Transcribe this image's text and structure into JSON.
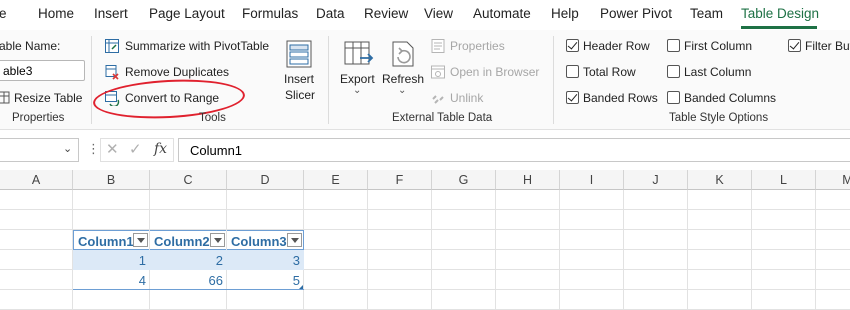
{
  "menu": {
    "tabs": [
      "e",
      "Home",
      "Insert",
      "Page Layout",
      "Formulas",
      "Data",
      "Review",
      "View",
      "Automate",
      "Help",
      "Power Pivot",
      "Team",
      "Table Design"
    ],
    "active": "Table Design"
  },
  "ribbon": {
    "properties": {
      "table_name_label": "able Name:",
      "table_name_value": "able3",
      "resize_label": "Resize Table",
      "group_label": "Properties"
    },
    "tools": {
      "summarize_label": "Summarize with PivotTable",
      "remove_duplicates_label": "Remove Duplicates",
      "convert_label": "Convert to Range",
      "insert_slicer_line1": "Insert",
      "insert_slicer_line2": "Slicer",
      "group_label": "Tools"
    },
    "external": {
      "export_label": "Export",
      "refresh_label": "Refresh",
      "properties_label": "Properties",
      "open_browser_label": "Open in Browser",
      "unlink_label": "Unlink",
      "group_label": "External Table Data"
    },
    "style_options": {
      "header_row": "Header Row",
      "total_row": "Total Row",
      "banded_rows": "Banded Rows",
      "first_column": "First Column",
      "last_column": "Last Column",
      "banded_columns": "Banded Columns",
      "filter_button": "Filter Butt",
      "header_row_checked": true,
      "total_row_checked": false,
      "banded_rows_checked": true,
      "first_column_checked": false,
      "last_column_checked": false,
      "banded_columns_checked": false,
      "filter_button_checked": true,
      "group_label": "Table Style Options"
    }
  },
  "formula_bar": {
    "fx": "fx",
    "value": "Column1"
  },
  "grid": {
    "columns": [
      "A",
      "B",
      "C",
      "D",
      "E",
      "F",
      "G",
      "H",
      "I",
      "J",
      "K",
      "L",
      "M"
    ],
    "table": {
      "headers": [
        "Column1",
        "Column2",
        "Column3"
      ],
      "rows": [
        [
          "1",
          "2",
          "3"
        ],
        [
          "4",
          "66",
          "5"
        ]
      ]
    }
  },
  "colors": {
    "accent_green": "#1e7145",
    "annotation_red": "#e0212e",
    "table_blue": "#2e6da4",
    "band_fill": "#dce9f7"
  }
}
